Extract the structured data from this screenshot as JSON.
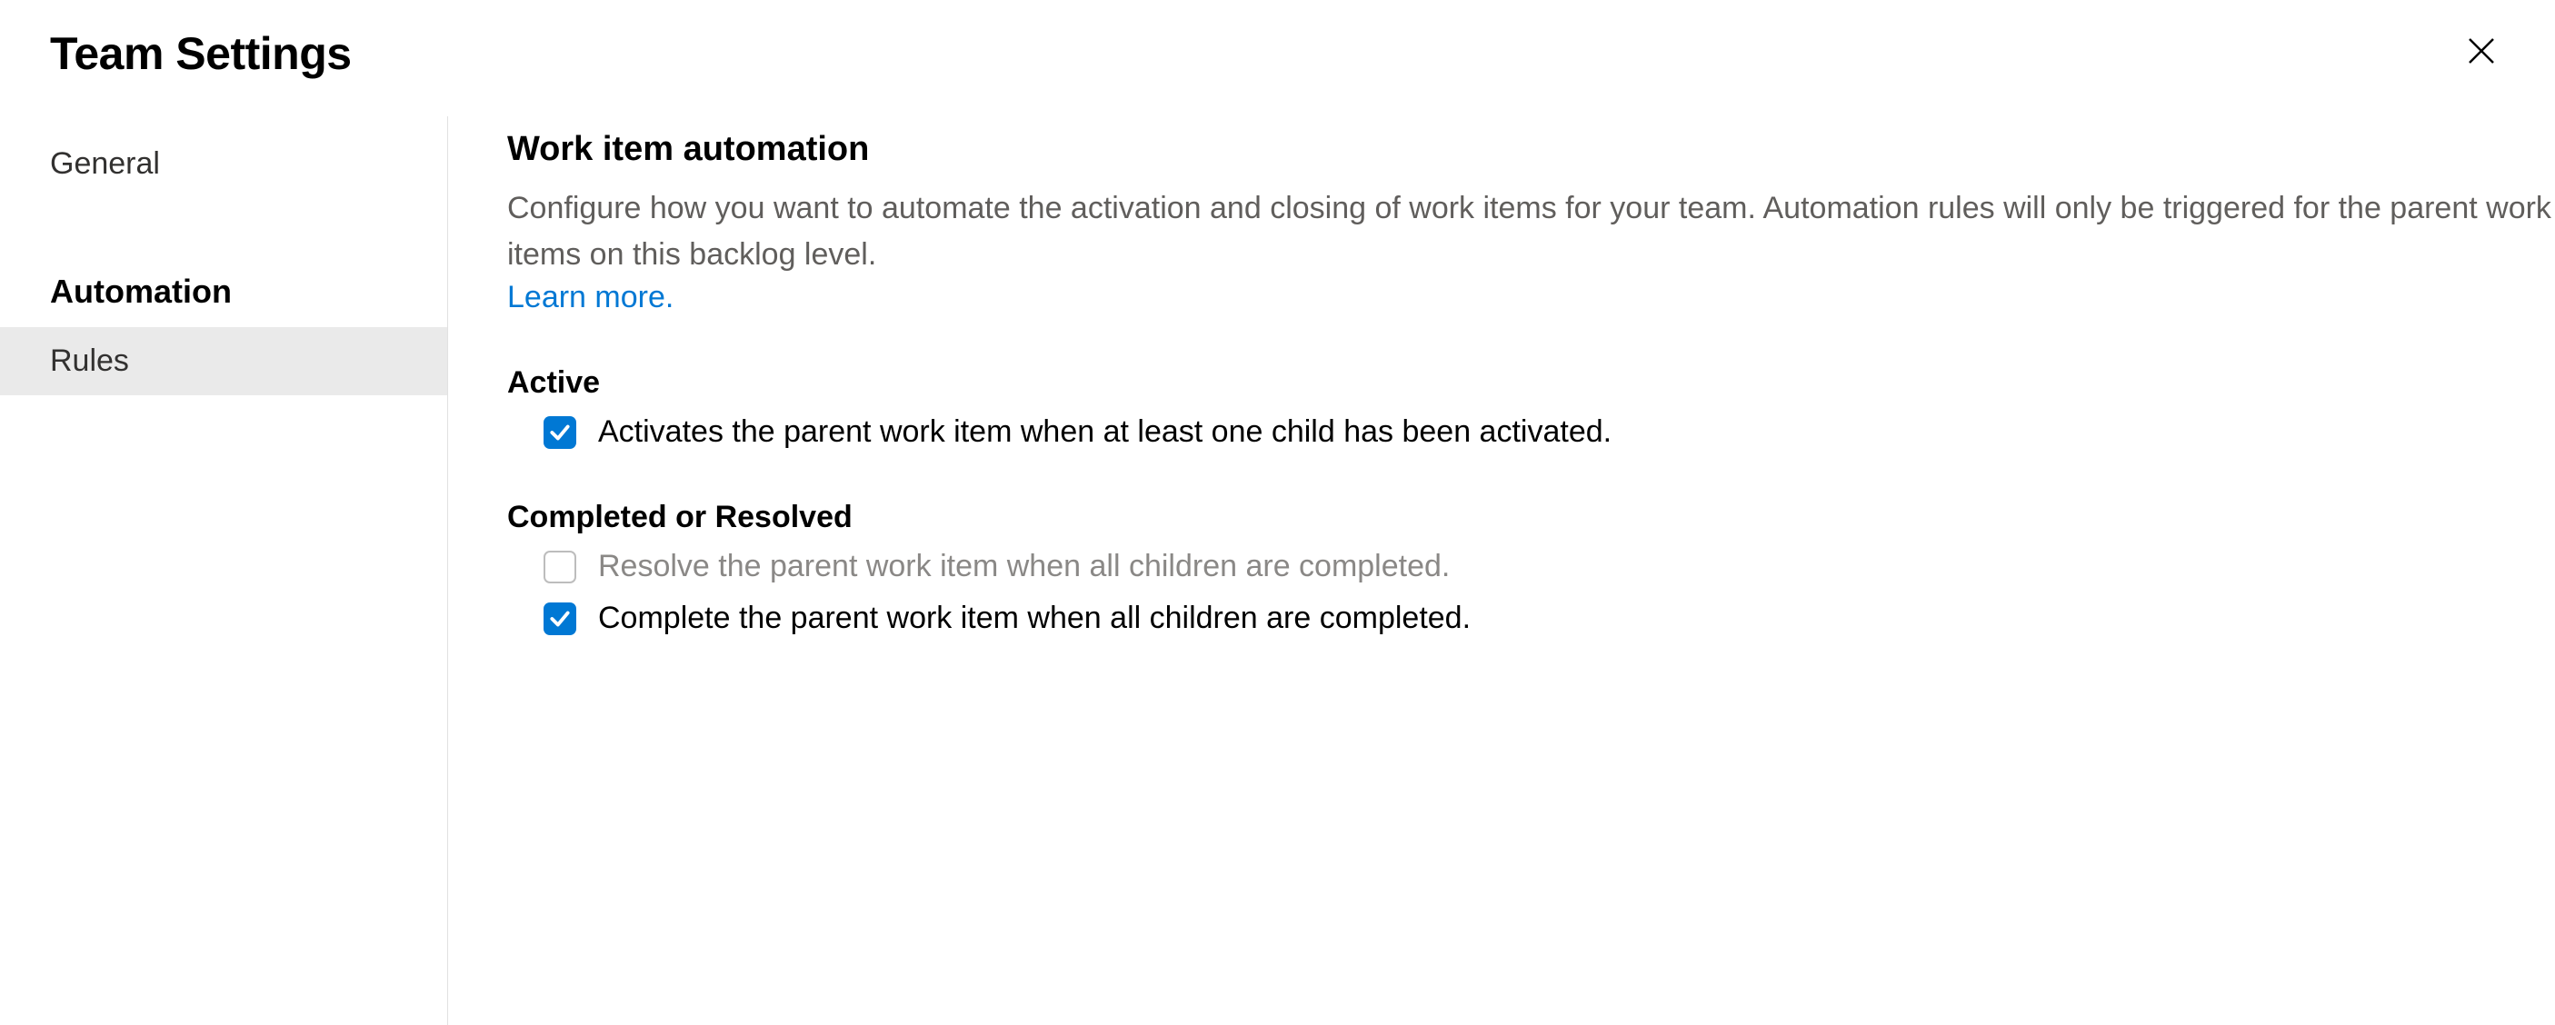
{
  "header": {
    "title": "Team Settings"
  },
  "sidebar": {
    "items": [
      {
        "label": "General",
        "type": "link",
        "selected": false
      },
      {
        "label": "Automation",
        "type": "heading"
      },
      {
        "label": "Rules",
        "type": "link",
        "selected": true
      }
    ]
  },
  "content": {
    "section_title": "Work item automation",
    "description": "Configure how you want to automate the activation and closing of work items for your team. Automation rules will only be triggered for the parent work items on this backlog level.",
    "learn_more": "Learn more.",
    "groups": [
      {
        "heading": "Active",
        "rules": [
          {
            "label": "Activates the parent work item when at least one child has been activated.",
            "checked": true,
            "enabled": true
          }
        ]
      },
      {
        "heading": "Completed or Resolved",
        "rules": [
          {
            "label": "Resolve the parent work item when all children are completed.",
            "checked": false,
            "enabled": false
          },
          {
            "label": "Complete the parent work item when all children are completed.",
            "checked": true,
            "enabled": true
          }
        ]
      }
    ]
  }
}
